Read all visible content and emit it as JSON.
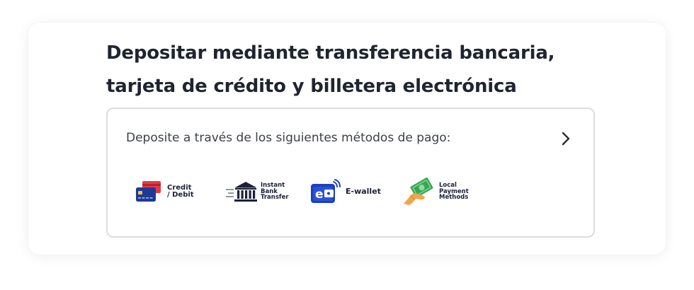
{
  "title": "Depositar mediante transferencia bancaria, tarjeta de crédito y billetera electrónica",
  "methods_box": {
    "label": "Deposite a través de los siguientes métodos de pago:",
    "chevron_icon": "chevron-right-icon"
  },
  "payment_methods": [
    {
      "icon": "credit-card-icon",
      "line1": "Credit",
      "line2": "/ Debit"
    },
    {
      "icon": "bank-icon",
      "line1": "Instant",
      "line2": "Bank",
      "line3": "Transfer"
    },
    {
      "icon": "e-wallet-icon",
      "line1": "E-wallet"
    },
    {
      "icon": "local-payment-icon",
      "line1": "Local",
      "line2": "Payment",
      "line3": "Methods"
    }
  ],
  "colors": {
    "title": "#1f2430",
    "text": "#3b3f47",
    "border": "#dcdde1",
    "card_blue": "#1f3a93",
    "card_red": "#e63946",
    "wallet_blue": "#1d3fbb",
    "money_green": "#3aa655",
    "hand_orange": "#f2a64a"
  }
}
